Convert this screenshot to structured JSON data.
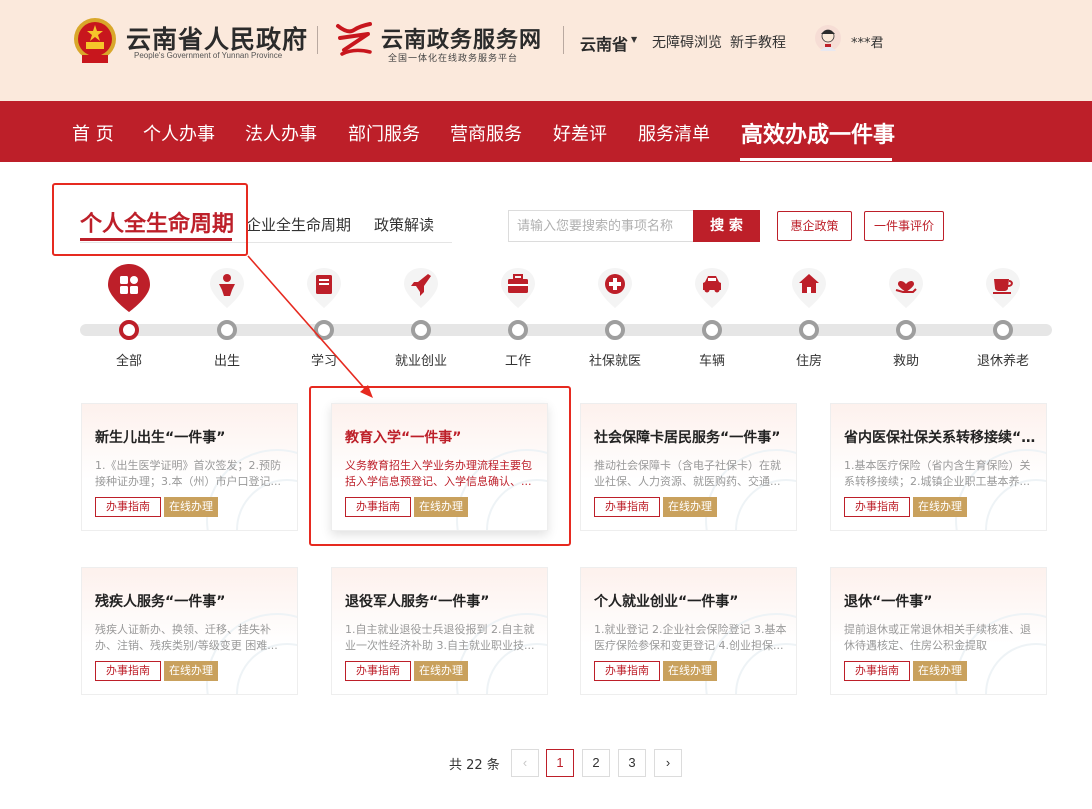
{
  "header": {
    "gov_title": "云南省人民政府",
    "gov_subtitle": "People's Government of Yunnan Province",
    "portal_title": "云南政务服务网",
    "portal_subtitle": "全国一体化在线政务服务平台",
    "region": "云南省",
    "accessibility_link": "无障碍浏览",
    "tutorial_link": "新手教程",
    "user_name": "***君"
  },
  "nav": {
    "items": [
      "首 页",
      "个人办事",
      "法人办事",
      "部门服务",
      "营商服务",
      "好差评",
      "服务清单",
      "高效办成一件事"
    ],
    "active_index": 7
  },
  "tabs": {
    "items": [
      "个人全生命周期",
      "企业全生命周期",
      "政策解读"
    ],
    "active_index": 0
  },
  "search": {
    "placeholder": "请输入您要搜索的事项名称",
    "button_label": "搜 索"
  },
  "action_buttons": [
    "惠企政策",
    "一件事评价"
  ],
  "timeline": {
    "items": [
      "全部",
      "出生",
      "学习",
      "就业创业",
      "工作",
      "社保就医",
      "车辆",
      "住房",
      "救助",
      "退休养老"
    ],
    "active_index": 0
  },
  "cards": [
    {
      "title": "新生儿出生“一件事”",
      "desc": "1.《出生医学证明》首次签发；2.预防接种证办理；3.本（州）市户口登记..."
    },
    {
      "title": "教育入学“一件事”",
      "desc": "义务教育招生入学业务办理流程主要包括入学信息预登记、入学信息确认、..."
    },
    {
      "title": "社会保障卡居民服务“一件事”",
      "desc": "推动社会保障卡（含电子社保卡）在就业社保、人力资源、就医购药、交通..."
    },
    {
      "title": "省内医保社保关系转移接续“一件事”",
      "desc": "1.基本医疗保险（省内含生育保险）关系转移接续；2.城镇企业职工基本养..."
    },
    {
      "title": "残疾人服务“一件事”",
      "desc": "残疾人证新办、换领、迁移、挂失补办、注销、残疾类别/等级变更 困难..."
    },
    {
      "title": "退役军人服务“一件事”",
      "desc": "1.自主就业退役士兵退役报到 2.自主就业一次性经济补助 3.自主就业职业技..."
    },
    {
      "title": "个人就业创业“一件事”",
      "desc": "1.就业登记 2.企业社会保险登记 3.基本医疗保险参保和变更登记 4.创业担保..."
    },
    {
      "title": "退休“一件事”",
      "desc": "提前退休或正常退休相关手续核准、退休待遇核定、住房公积金提取"
    }
  ],
  "card_tags": {
    "guide": "办事指南",
    "online": "在线办理"
  },
  "pagination": {
    "total_text": "共 22 条",
    "prev": "‹",
    "next": "›",
    "pages": [
      "1",
      "2",
      "3"
    ],
    "current": "1"
  },
  "colors": {
    "brand_red": "#bd1f29",
    "header_bg": "#fbe9dc",
    "gold_tag": "#c9a15d",
    "annotation_red": "#e62a20"
  }
}
